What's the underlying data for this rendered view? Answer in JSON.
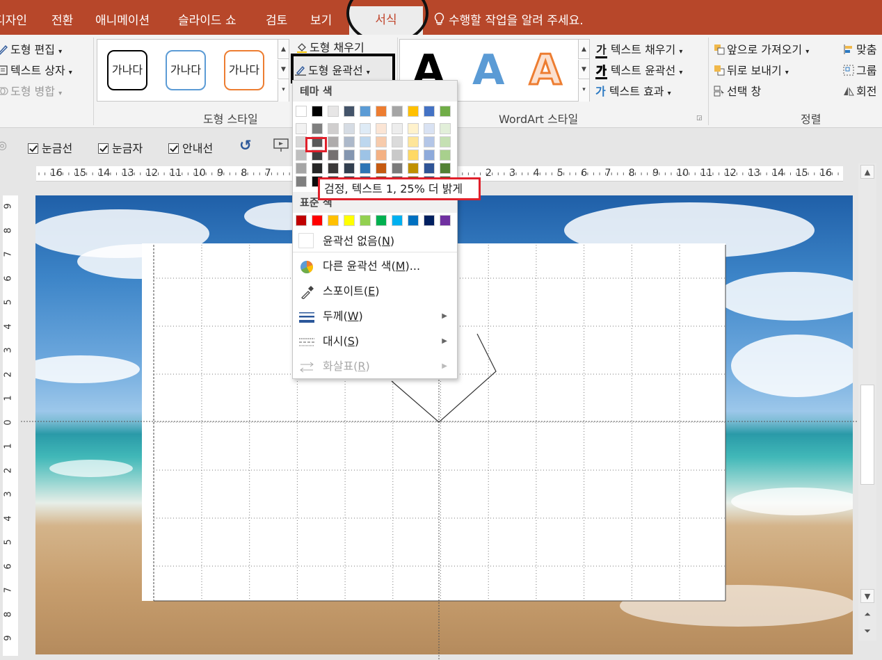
{
  "tabs": {
    "design": "디자인",
    "transitions": "전환",
    "animations": "애니메이션",
    "slideshow": "슬라이드 쇼",
    "review": "검토",
    "view": "보기",
    "format": "서식",
    "tell_me": "수행할 작업을 알려 주세요."
  },
  "ribbon": {
    "edit_shape": "도형 편집",
    "text_box": "텍스트 상자",
    "merge_shapes": "도형 병합",
    "shape_style_sample": "가나다",
    "shape_styles_label": "도형 스타일",
    "shape_fill": "도형 채우기",
    "shape_outline": "도형 윤곽선",
    "wordart_letter": "A",
    "wordart_styles_label": "WordArt 스타일",
    "text_fill": "텍스트 채우기",
    "text_outline": "텍스트 윤곽선",
    "text_effects": "텍스트 효과",
    "text_icon_letter": "가",
    "bring_forward": "앞으로 가져오기",
    "send_backward": "뒤로 보내기",
    "selection_pane": "선택 창",
    "arrange_label": "정렬",
    "align": "맞춤",
    "group": "그룹",
    "rotate": "회전"
  },
  "toolbar": {
    "gridlines": "눈금선",
    "ruler": "눈금자",
    "guides": "안내선"
  },
  "ruler": {
    "horizontal_left": [
      "16",
      "15",
      "14",
      "13",
      "12",
      "11",
      "10",
      "9",
      "8",
      "7"
    ],
    "horizontal_right": [
      "2",
      "3",
      "4",
      "5",
      "6",
      "7",
      "8",
      "9",
      "10",
      "11",
      "12",
      "13",
      "14",
      "15",
      "16"
    ],
    "vertical": [
      "9",
      "8",
      "7",
      "6",
      "5",
      "4",
      "3",
      "2",
      "1",
      "0",
      "1",
      "2",
      "3",
      "4",
      "5",
      "6",
      "7",
      "8",
      "9"
    ]
  },
  "dropdown": {
    "theme_colors_header": "테마 색",
    "standard_colors_header": "표준 색",
    "theme_colors_top": [
      "#ffffff",
      "#000000",
      "#e7e6e6",
      "#44546a",
      "#5b9bd5",
      "#ed7d31",
      "#a5a5a5",
      "#ffc000",
      "#4472c4",
      "#70ad47"
    ],
    "theme_colors_shades": [
      [
        "#f2f2f2",
        "#7f7f7f",
        "#d0cece",
        "#d6dce4",
        "#deebf6",
        "#fbe5d5",
        "#ededed",
        "#fff2cc",
        "#d9e2f3",
        "#e2efd9"
      ],
      [
        "#d8d8d8",
        "#595959",
        "#aeabab",
        "#adb9ca",
        "#bdd7ee",
        "#f7cbac",
        "#dbdbdb",
        "#fee599",
        "#b4c6e7",
        "#c5e0b3"
      ],
      [
        "#bfbfbf",
        "#3f3f3f",
        "#757070",
        "#8496b0",
        "#9dc3e6",
        "#f4b183",
        "#c9c9c9",
        "#ffd965",
        "#8eaadb",
        "#a8d08d"
      ],
      [
        "#a5a5a5",
        "#262626",
        "#3a3838",
        "#323f4f",
        "#2e75b5",
        "#c55a11",
        "#7b7b7b",
        "#bf9000",
        "#2f5496",
        "#538135"
      ],
      [
        "#7f7f7f",
        "#0c0c0c",
        "#171616",
        "#222a35",
        "#1e4e79",
        "#833c0b",
        "#525252",
        "#7f6000",
        "#1f3864",
        "#375623"
      ]
    ],
    "standard_colors": [
      "#c00000",
      "#ff0000",
      "#ffc000",
      "#ffff00",
      "#92d050",
      "#00b050",
      "#00b0f0",
      "#0070c0",
      "#002060",
      "#7030a0"
    ],
    "no_outline": "윤곽선 없음(",
    "no_outline_key": "N",
    "more_colors": "다른 윤곽선 색(",
    "more_colors_key": "M",
    "more_colors_suffix": ")...",
    "eyedropper": "스포이트(",
    "eyedropper_key": "E",
    "weight": "두께(",
    "weight_key": "W",
    "dashes": "대시(",
    "dashes_key": "S",
    "arrows": "화살표(",
    "arrows_key": "R",
    "close_paren": ")"
  },
  "tooltip": "검정, 텍스트 1, 25% 더 밝게"
}
